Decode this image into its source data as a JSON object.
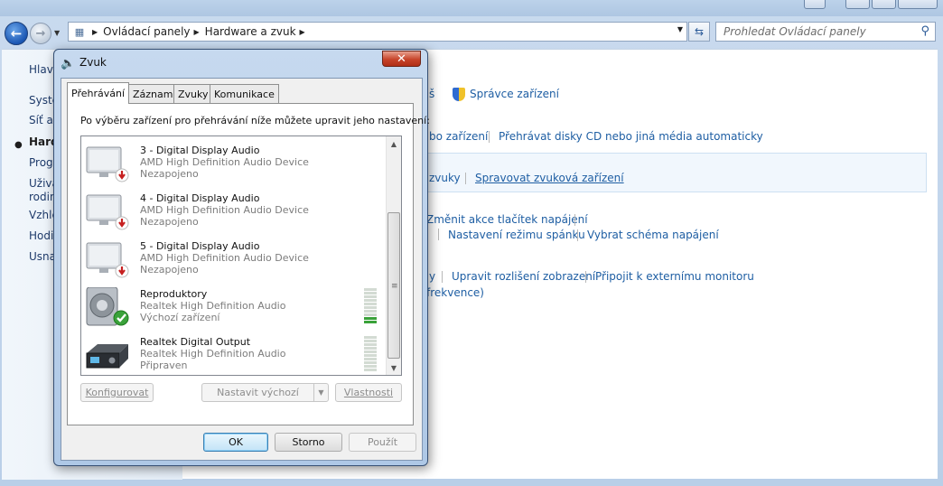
{
  "explorer": {
    "address": {
      "crumbs": [
        "Ovládací panely",
        "Hardware a zvuk"
      ]
    },
    "search": {
      "placeholder": "Prohledat Ovládací panely"
    },
    "left_pane": {
      "items": [
        "Hlavn",
        "Systé",
        "Síť a I",
        "Hard",
        "Progr",
        "Uživa",
        "rodin",
        "Vzhle",
        "Hodi",
        "Usnad"
      ]
    },
    "right_pane": {
      "row1": {
        "tail": "š",
        "device_manager": "Správce zařízení"
      },
      "row2": {
        "tail": "bo zařízení",
        "autoplay": "Přehrávat disky CD nebo jiná média automaticky"
      },
      "row3": {
        "tail": "zvuky",
        "manage_audio": "Spravovat zvuková zařízení"
      },
      "row4": {
        "power_buttons": "Změnit akce tlačítek napájení",
        "sleep": "Nastavení režimu spánku",
        "power_plan": "Vybrat schéma napájení"
      },
      "row5": {
        "tail": "y",
        "resolution": "Upravit rozlišení zobrazení",
        "external_monitor": "Připojit k externímu monitoru",
        "tail2": "frekvence)"
      }
    }
  },
  "dialog": {
    "title": "Zvuk",
    "close_symbol": "✕",
    "tabs": [
      "Přehrávání",
      "Záznam",
      "Zvuky",
      "Komunikace"
    ],
    "instruction": "Po výběru zařízení pro přehrávání níže můžete upravit jeho nastavení:",
    "devices": [
      {
        "name": "3 - Digital Display Audio",
        "driver": "AMD High Definition Audio Device",
        "status": "Nezapojeno",
        "icon": "monitor-icon",
        "badge": "unplugged"
      },
      {
        "name": "4 - Digital Display Audio",
        "driver": "AMD High Definition Audio Device",
        "status": "Nezapojeno",
        "icon": "monitor-icon",
        "badge": "unplugged"
      },
      {
        "name": "5 - Digital Display Audio",
        "driver": "AMD High Definition Audio Device",
        "status": "Nezapojeno",
        "icon": "monitor-icon",
        "badge": "unplugged"
      },
      {
        "name": "Reproduktory",
        "driver": "Realtek High Definition Audio",
        "status": "Výchozí zařízení",
        "icon": "speaker-icon",
        "badge": "default",
        "level": 0.2
      },
      {
        "name": "Realtek Digital Output",
        "driver": "Realtek High Definition Audio",
        "status": "Připraven",
        "icon": "receiver-icon",
        "level": 0
      }
    ],
    "buttons": {
      "configure": "Konfigurovat",
      "set_default": "Nastavit výchozí",
      "properties": "Vlastnosti",
      "ok": "OK",
      "cancel": "Storno",
      "apply": "Použít"
    }
  }
}
